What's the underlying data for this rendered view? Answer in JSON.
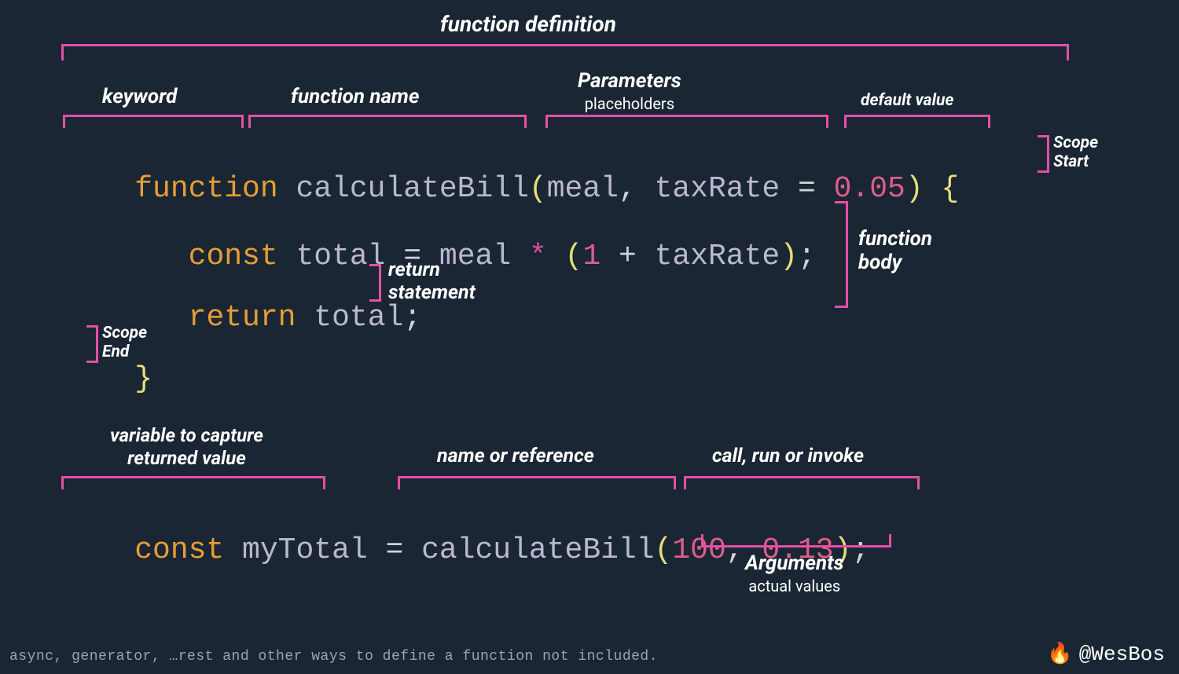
{
  "labels": {
    "function_definition": "function definition",
    "keyword": "keyword",
    "function_name": "function name",
    "parameters": "Parameters",
    "parameters_sub": "placeholders",
    "default_value": "default value",
    "scope_start": "Scope\nStart",
    "function_body": "function\nbody",
    "return_statement": "return\nstatement",
    "scope_end": "Scope\nEnd",
    "variable_capture": "variable to capture\nreturned value",
    "name_reference": "name or reference",
    "call_invoke": "call, run or invoke",
    "arguments": "Arguments",
    "arguments_sub": "actual values"
  },
  "code": {
    "l1": {
      "function": "function ",
      "name": "calculateBill",
      "open": "(",
      "p1": "meal",
      "comma": ", ",
      "p2": "taxRate ",
      "eq": "= ",
      "num": "0.05",
      "close": ") ",
      "brace": "{"
    },
    "l2": {
      "indent": "   ",
      "const": "const ",
      "total": "total ",
      "eq": "= ",
      "meal": "meal ",
      "star": "* ",
      "open": "(",
      "one": "1 ",
      "plus": "+ ",
      "tax": "taxRate",
      "close": ")",
      "semi": ";"
    },
    "l3": {
      "indent": "   ",
      "return": "return ",
      "total": "total",
      "semi": ";"
    },
    "l4": {
      "brace": "}"
    },
    "l5": {
      "const": "const ",
      "var": "myTotal ",
      "eq": "= ",
      "name": "calculateBill",
      "open": "(",
      "a1": "100",
      "comma": ", ",
      "a2": "0.13",
      "close": ")",
      "semi": ";"
    }
  },
  "footer": "async, generator, …rest and other ways to define a function not included.",
  "credit": "@WesBos"
}
